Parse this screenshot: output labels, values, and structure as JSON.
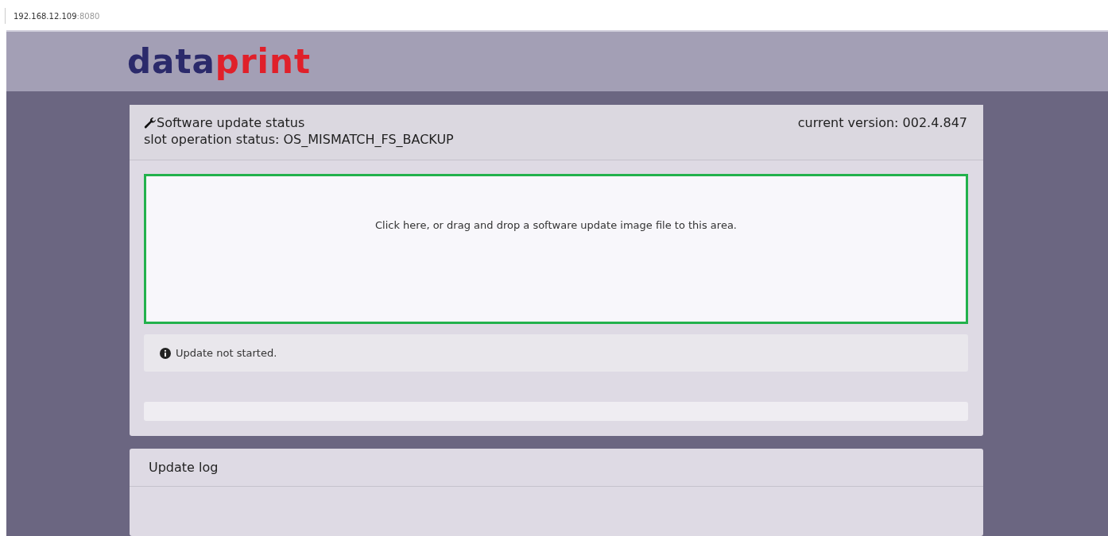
{
  "address_bar": {
    "host": "192.168.12.109",
    "port": ":8080"
  },
  "logo": {
    "first": "data",
    "second": "print"
  },
  "update_panel": {
    "title": "Software update status",
    "slot_status": "slot operation status: OS_MISMATCH_FS_BACKUP",
    "version": "current version: 002.4.847",
    "dropzone": "Click here, or drag and drop a software update image file to this area.",
    "message": "Update not started.",
    "progress": {
      "level": 0
    }
  },
  "log_panel": {
    "title": "Update log"
  }
}
